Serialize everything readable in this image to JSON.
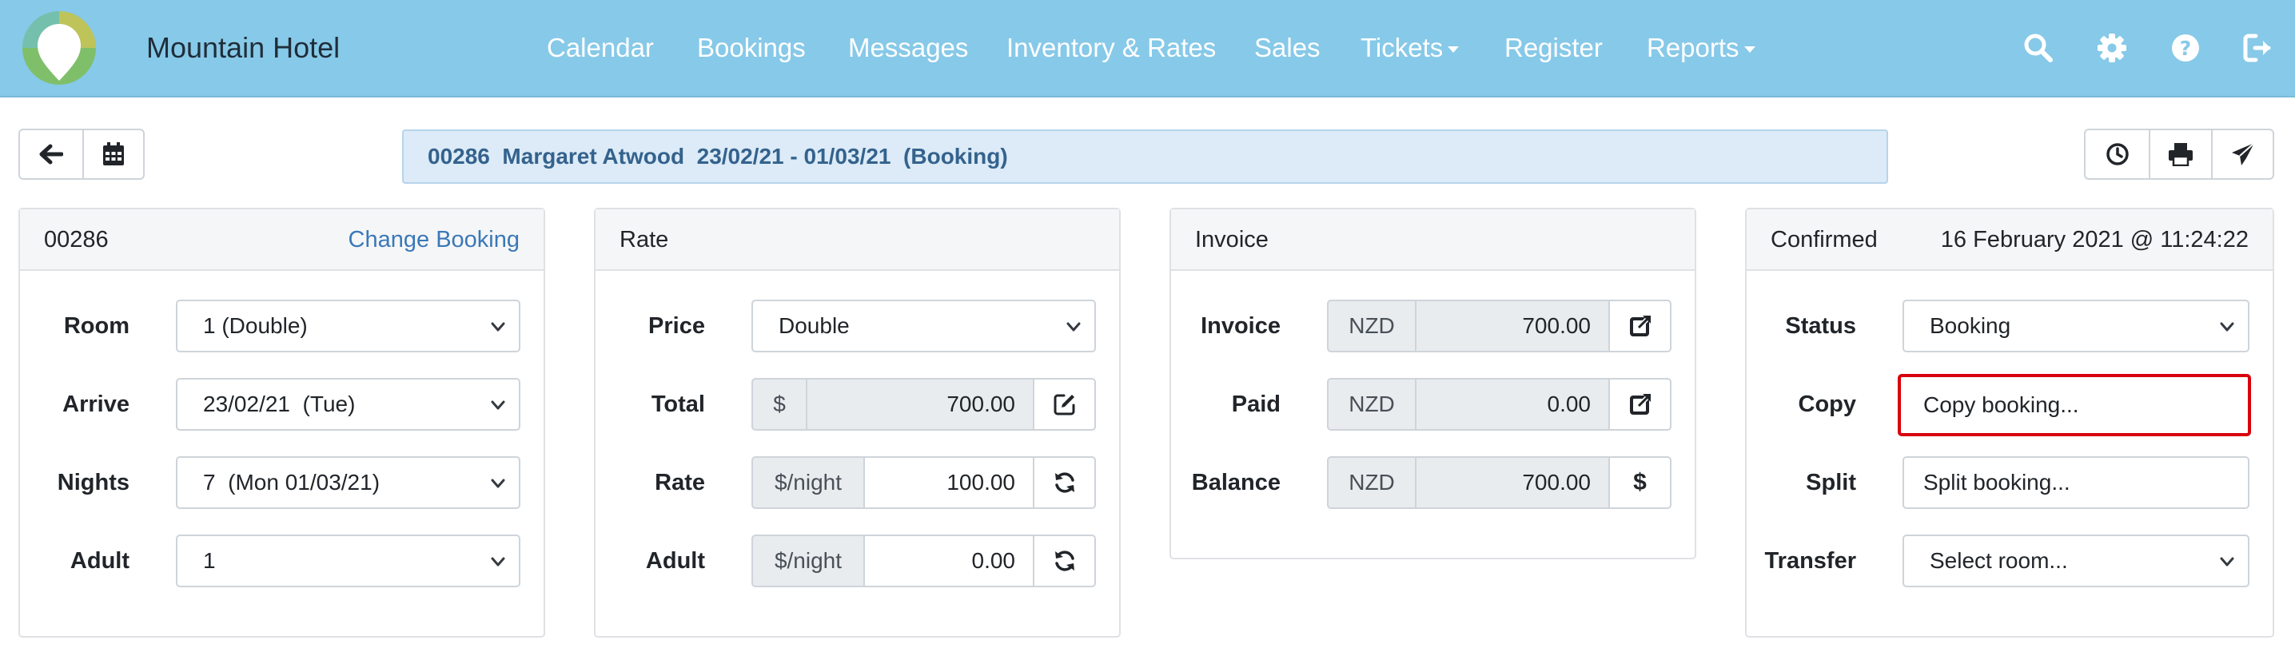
{
  "navbar": {
    "brand": "Mountain Hotel",
    "links": [
      "Calendar",
      "Bookings",
      "Messages",
      "Inventory & Rates",
      "Sales",
      "Tickets",
      "Register",
      "Reports"
    ]
  },
  "booking_title": "00286  Margaret Atwood  23/02/21 - 01/03/21  (Booking)",
  "booking_card": {
    "title": "00286",
    "change_link": "Change Booking",
    "rows": [
      {
        "label": "Room",
        "value": "1 (Double)"
      },
      {
        "label": "Arrive",
        "value": "23/02/21  (Tue)"
      },
      {
        "label": "Nights",
        "value": "7  (Mon 01/03/21)"
      },
      {
        "label": "Adult",
        "value": "1"
      }
    ]
  },
  "rate_card": {
    "title": "Rate",
    "price_label": "Price",
    "price_value": "Double",
    "total": {
      "label": "Total",
      "prefix": "$",
      "value": "700.00"
    },
    "rate": {
      "label": "Rate",
      "prefix": "$/night",
      "value": "100.00"
    },
    "adult": {
      "label": "Adult",
      "prefix": "$/night",
      "value": "0.00"
    }
  },
  "invoice_card": {
    "title": "Invoice",
    "invoice": {
      "label": "Invoice",
      "currency": "NZD",
      "value": "700.00"
    },
    "paid": {
      "label": "Paid",
      "currency": "NZD",
      "value": "0.00"
    },
    "balance": {
      "label": "Balance",
      "currency": "NZD",
      "value": "700.00",
      "button": "$"
    }
  },
  "status_card": {
    "title": "Confirmed",
    "timestamp": "16 February 2021 @ 11:24:22",
    "status": {
      "label": "Status",
      "value": "Booking"
    },
    "copy": {
      "label": "Copy",
      "value": "Copy booking..."
    },
    "split": {
      "label": "Split",
      "value": "Split booking..."
    },
    "transfer": {
      "label": "Transfer",
      "value": "Select room..."
    }
  },
  "colors": {
    "navbar": "#87c9e8",
    "title_bar": "#dcebf7",
    "title_text": "#34628d",
    "link": "#3a78b8",
    "highlight": "#d8000c"
  }
}
